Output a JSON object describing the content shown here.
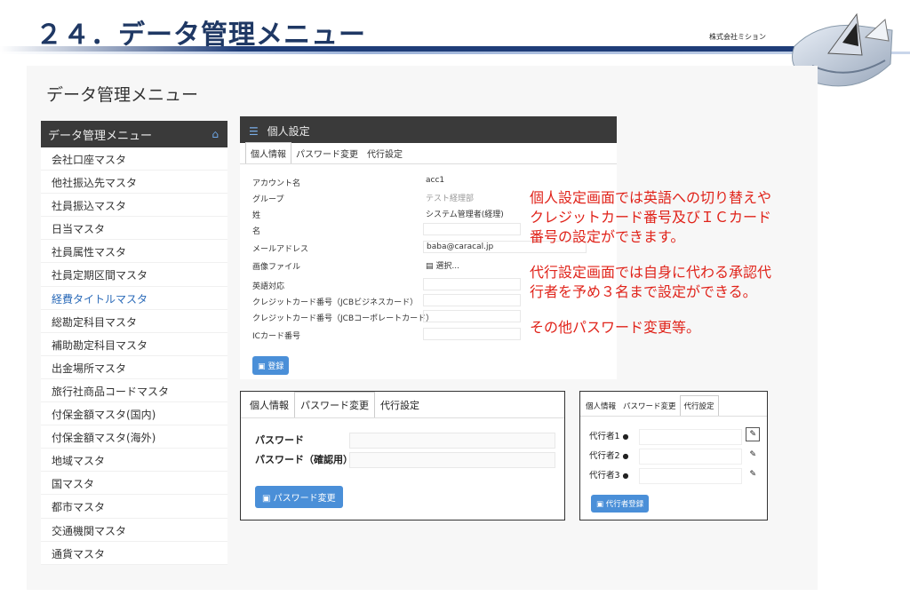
{
  "slide": {
    "title": "２４．データ管理メニュー",
    "company": "株式会社ミション"
  },
  "page_title": "データ管理メニュー",
  "sidebar": {
    "header": "データ管理メニュー",
    "items": [
      "会社口座マスタ",
      "他社振込先マスタ",
      "社員振込マスタ",
      "日当マスタ",
      "社員属性マスタ",
      "社員定期区間マスタ",
      "経費タイトルマスタ",
      "総勘定科目マスタ",
      "補助勘定科目マスタ",
      "出金場所マスタ",
      "旅行社商品コードマスタ",
      "付保金額マスタ(国内)",
      "付保金額マスタ(海外)",
      "地域マスタ",
      "国マスタ",
      "都市マスタ",
      "交通機関マスタ",
      "通貨マスタ"
    ]
  },
  "panel": {
    "title": "個人設定",
    "tabs": [
      "個人情報",
      "パスワード変更",
      "代行設定"
    ],
    "fields": [
      {
        "label": "アカウント名",
        "value": "acc1"
      },
      {
        "label": "グループ",
        "value": "テスト経理部"
      },
      {
        "label": "姓",
        "value": "システム管理者(経理)"
      },
      {
        "label": "名",
        "value": ""
      },
      {
        "label": "メールアドレス",
        "value": "baba@caracal.jp"
      },
      {
        "label": "画像ファイル",
        "value": "選択..."
      },
      {
        "label": "英語対応",
        "value": ""
      },
      {
        "label": "クレジットカード番号（JCBビジネスカード）",
        "value": ""
      },
      {
        "label": "クレジットカード番号（JCBコーポレートカード）",
        "value": ""
      },
      {
        "label": "ICカード番号",
        "value": ""
      }
    ],
    "save_button": "登録"
  },
  "notes": [
    "個人設定画面では英語への切り替えや",
    "クレジットカード番号及びＩＣカード",
    "番号の設定ができます。",
    "代行設定画面では自身に代わる承認代",
    "行者を予め３名まで設定ができる。",
    "その他パスワード変更等。"
  ],
  "password_panel": {
    "tabs": [
      "個人情報",
      "パスワード変更",
      "代行設定"
    ],
    "password_label": "パスワード",
    "confirm_label": "パスワード（確認用）",
    "button": "パスワード変更"
  },
  "delegate_panel": {
    "tabs": [
      "個人情報",
      "パスワード変更",
      "代行設定"
    ],
    "rows": [
      "代行者1",
      "代行者2",
      "代行者3"
    ],
    "button": "代行者登録"
  },
  "colors": {
    "title_navy": "#1f3864",
    "note_red": "#e0231a",
    "button_blue": "#4a8fd8",
    "header_dark": "#3a3a3a"
  }
}
